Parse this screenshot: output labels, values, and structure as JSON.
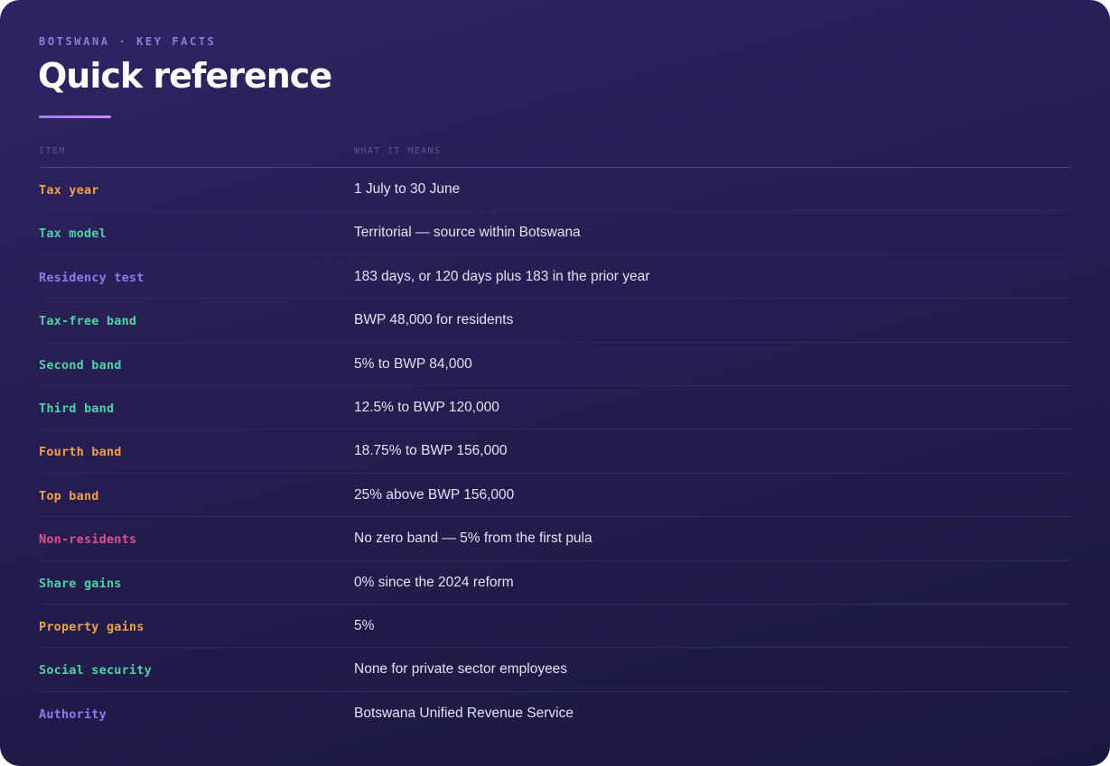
{
  "header": {
    "eyebrow": "BOTSWANA · KEY FACTS",
    "title": "Quick reference"
  },
  "table": {
    "columns": [
      "ITEM",
      "WHAT IT MEANS"
    ],
    "rows": [
      {
        "item": "Tax year",
        "meaning": "1 July to 30 June",
        "color": "#f0a04b"
      },
      {
        "item": "Tax model",
        "meaning": "Territorial — source within Botswana",
        "color": "#4fd1a5"
      },
      {
        "item": "Residency test",
        "meaning": "183 days, or 120 days plus 183 in the prior year",
        "color": "#8c7bec"
      },
      {
        "item": "Tax-free band",
        "meaning": "BWP 48,000 for residents",
        "color": "#4fd1a5"
      },
      {
        "item": "Second band",
        "meaning": "5% to BWP 84,000",
        "color": "#4fd1a5"
      },
      {
        "item": "Third band",
        "meaning": "12.5% to BWP 120,000",
        "color": "#4fd1a5"
      },
      {
        "item": "Fourth band",
        "meaning": "18.75% to BWP 156,000",
        "color": "#f0a04b"
      },
      {
        "item": "Top band",
        "meaning": "25% above BWP 156,000",
        "color": "#f0a04b"
      },
      {
        "item": "Non-residents",
        "meaning": "No zero band — 5% from the first pula",
        "color": "#e0508f"
      },
      {
        "item": "Share gains",
        "meaning": "0% since the 2024 reform",
        "color": "#4fd1a5"
      },
      {
        "item": "Property gains",
        "meaning": "5%",
        "color": "#f0a04b"
      },
      {
        "item": "Social security",
        "meaning": "None for private sector employees",
        "color": "#4fd1a5"
      },
      {
        "item": "Authority",
        "meaning": "Botswana Unified Revenue Service",
        "color": "#8c7bec"
      }
    ]
  }
}
